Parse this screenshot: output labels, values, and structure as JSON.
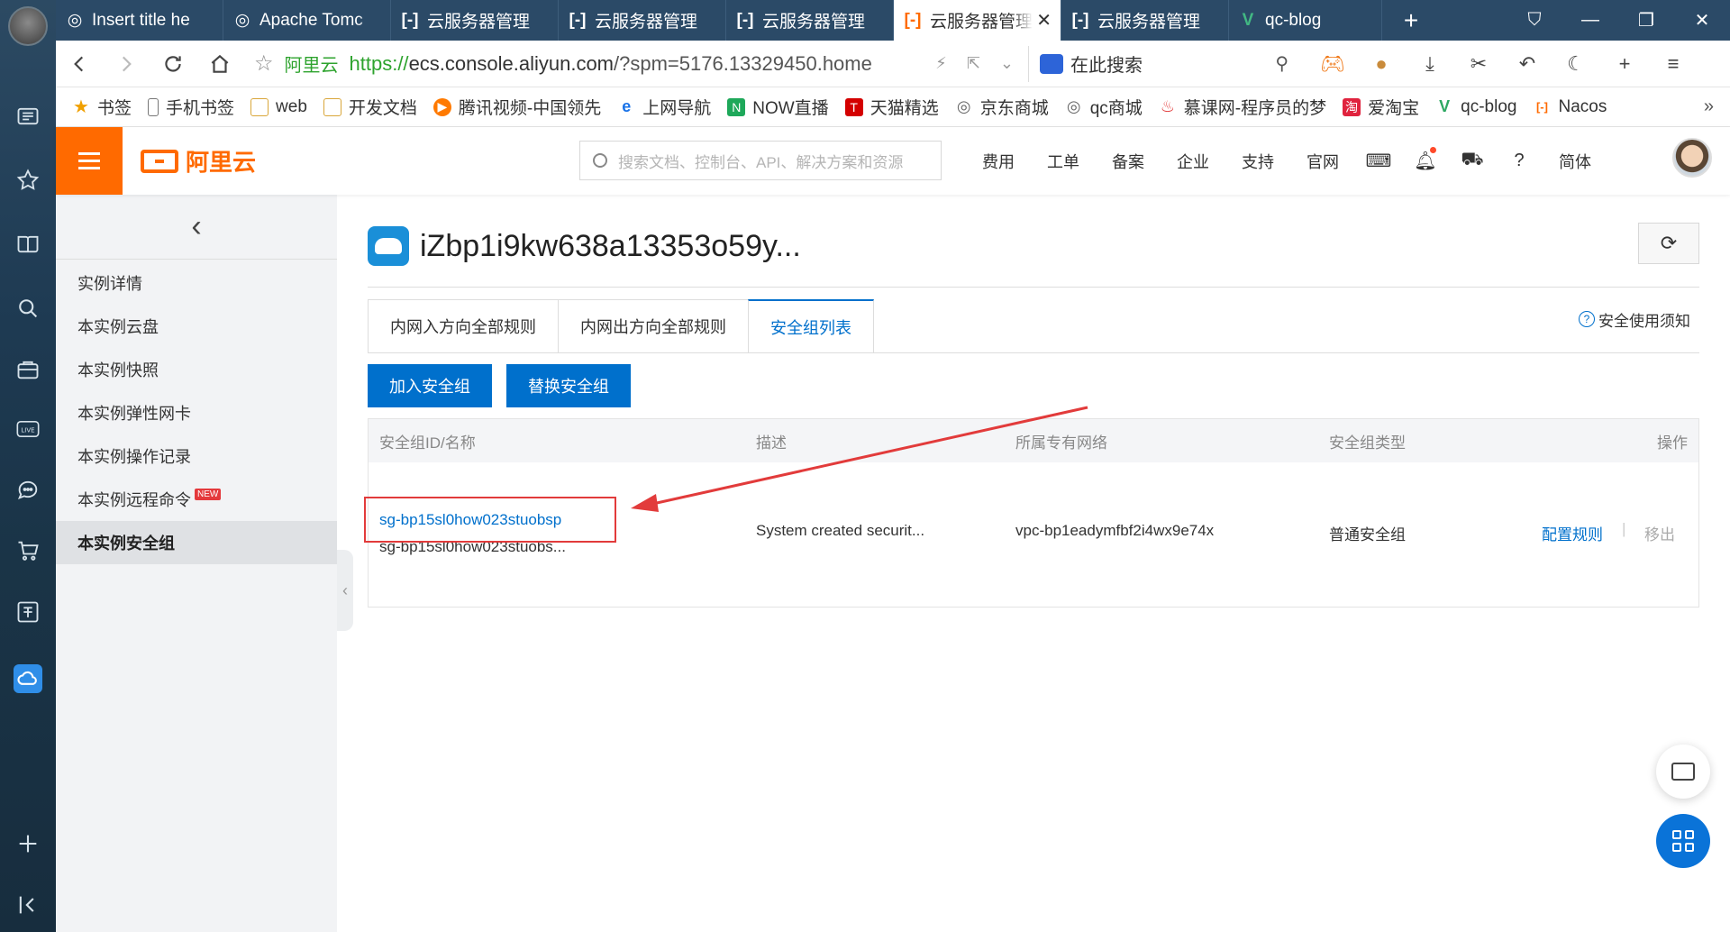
{
  "browser": {
    "tabs": [
      {
        "title": "Insert title he",
        "icon": "globe-icon",
        "active": false
      },
      {
        "title": "Apache Tomc",
        "icon": "globe-icon",
        "active": false
      },
      {
        "title": "云服务器管理",
        "icon": "aliyun-icon",
        "active": false
      },
      {
        "title": "云服务器管理",
        "icon": "aliyun-icon",
        "active": false
      },
      {
        "title": "云服务器管理",
        "icon": "aliyun-icon",
        "active": false
      },
      {
        "title": "云服务器管理",
        "icon": "aliyun-icon",
        "active": true
      },
      {
        "title": "云服务器管理",
        "icon": "aliyun-icon",
        "active": false
      },
      {
        "title": "qc-blog",
        "icon": "vue-icon",
        "active": false
      }
    ],
    "address": {
      "site_label": "阿里云",
      "url_scheme": "https://",
      "url_host": "ecs.console.aliyun.com",
      "url_rest": "/?spm=5176.13329450.home"
    },
    "search_placeholder": "在此搜索",
    "bookmarks": [
      {
        "label": "书签",
        "icon": "star-icon",
        "color": "#f0a000"
      },
      {
        "label": "手机书签",
        "icon": "phone-icon",
        "color": "#888888"
      },
      {
        "label": "web",
        "icon": "folder-icon",
        "color": "#e8b64a"
      },
      {
        "label": "开发文档",
        "icon": "folder-icon",
        "color": "#e8b64a"
      },
      {
        "label": "腾讯视频-中国领先",
        "icon": "tencent-video-icon",
        "color": "#ff7a00"
      },
      {
        "label": "上网导航",
        "icon": "ie-icon",
        "color": "#1a73e8"
      },
      {
        "label": "NOW直播",
        "icon": "now-icon",
        "color": "#1ea85a"
      },
      {
        "label": "天猫精选",
        "icon": "tmall-icon",
        "color": "#d40000"
      },
      {
        "label": "京东商城",
        "icon": "globe-icon",
        "color": "#888888"
      },
      {
        "label": "qc商城",
        "icon": "globe-icon",
        "color": "#888888"
      },
      {
        "label": "慕课网-程序员的梦",
        "icon": "fire-icon",
        "color": "#e23b3b"
      },
      {
        "label": "爱淘宝",
        "icon": "taobao-icon",
        "color": "#e0233e"
      },
      {
        "label": "qc-blog",
        "icon": "vue-icon",
        "color": "#2ea862"
      },
      {
        "label": "Nacos",
        "icon": "aliyun-icon",
        "color": "#ff6a00"
      }
    ]
  },
  "console": {
    "logo_text": "阿里云",
    "search_placeholder": "搜索文档、控制台、API、解决方案和资源",
    "nav": [
      "费用",
      "工单",
      "备案",
      "企业",
      "支持",
      "官网"
    ],
    "lang": "简体"
  },
  "sidebar": {
    "items": [
      {
        "label": "实例详情",
        "active": false,
        "badge": ""
      },
      {
        "label": "本实例云盘",
        "active": false,
        "badge": ""
      },
      {
        "label": "本实例快照",
        "active": false,
        "badge": ""
      },
      {
        "label": "本实例弹性网卡",
        "active": false,
        "badge": ""
      },
      {
        "label": "本实例操作记录",
        "active": false,
        "badge": ""
      },
      {
        "label": "本实例远程命令",
        "active": false,
        "badge": "NEW"
      },
      {
        "label": "本实例安全组",
        "active": true,
        "badge": ""
      }
    ]
  },
  "page": {
    "title": "iZbp1i9kw638a13353o59y...",
    "tabs": [
      "内网入方向全部规则",
      "内网出方向全部规则",
      "安全组列表"
    ],
    "active_tab": 2,
    "tip": "安全使用须知",
    "buttons": {
      "join": "加入安全组",
      "replace": "替换安全组"
    },
    "table": {
      "headers": [
        "安全组ID/名称",
        "描述",
        "所属专有网络",
        "安全组类型",
        "操作"
      ],
      "rows": [
        {
          "id": "sg-bp15sl0how023stuobsp",
          "name": "sg-bp15sl0how023stuobs...",
          "desc": "System created securit...",
          "vpc": "vpc-bp1eadymfbf2i4wx9e74x",
          "type": "普通安全组",
          "actions": [
            "配置规则",
            "移出"
          ]
        }
      ]
    }
  },
  "colors": {
    "accent": "#ff6a00",
    "link": "#0070cc",
    "annotation": "#e23b3b"
  }
}
